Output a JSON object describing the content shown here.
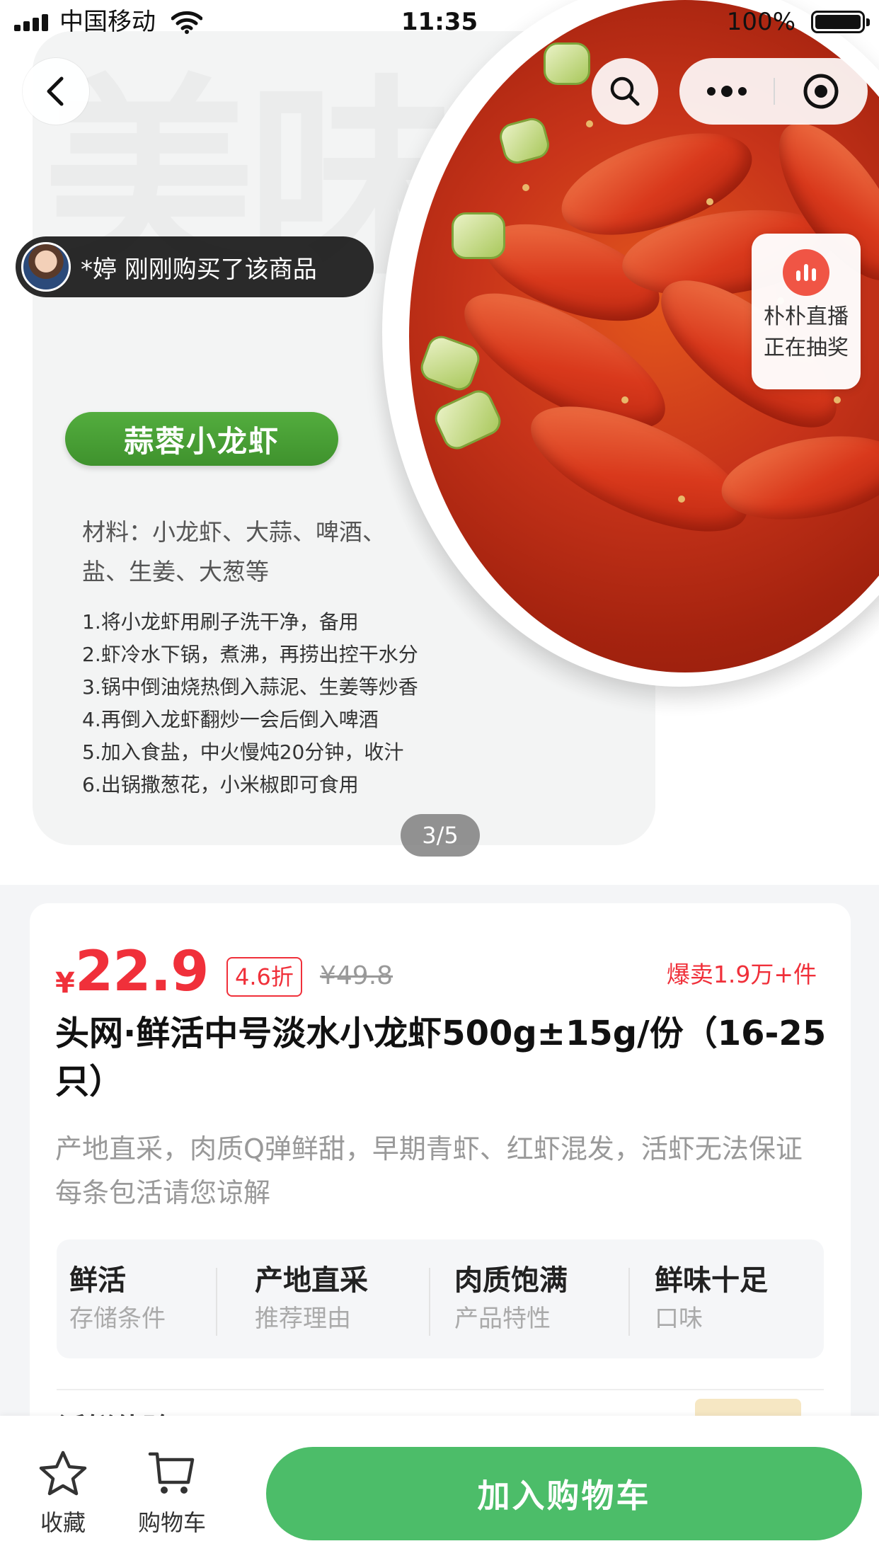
{
  "status_bar": {
    "carrier": "中国移动",
    "time": "11:35",
    "battery": "100%"
  },
  "hero": {
    "watermark": "美味",
    "purchase_toast": "*婷 刚刚购买了该商品",
    "live_badge": {
      "line1": "朴朴直播",
      "line2": "正在抽奖"
    },
    "dish_tag": "蒜蓉小龙虾",
    "materials": [
      "材料：小龙虾、大蒜、啤酒、",
      "盐、生姜、大葱等"
    ],
    "steps": [
      "1.将小龙虾用刷子洗干净，备用",
      "2.虾冷水下锅，煮沸，再捞出控干水分",
      "3.锅中倒油烧热倒入蒜泥、生姜等炒香",
      "4.再倒入龙虾翻炒一会后倒入啤酒",
      "5.加入食盐，中火慢炖20分钟，收汁",
      "6.出锅撒葱花，小米椒即可食用"
    ],
    "page_indicator": "3/5"
  },
  "product": {
    "currency": "¥",
    "price": "22.9",
    "discount": "4.6折",
    "original_price": "¥49.8",
    "sales": "爆卖1.9万+件",
    "title": "头网·鲜活中号淡水小龙虾500g±15g/份（16-25只）",
    "subtitle": "产地直采，肉质Q弹鲜甜，早期青虾、红虾混发，活虾无法保证每条包活请您谅解",
    "attributes": [
      {
        "value": "鲜活",
        "key": "存储条件"
      },
      {
        "value": "产地直采",
        "key": "推荐理由"
      },
      {
        "value": "肉质饱满",
        "key": "产品特性"
      },
      {
        "value": "鲜味十足",
        "key": "口味"
      }
    ],
    "next_section_peek": "活鲜体验"
  },
  "bottom_bar": {
    "favorite_label": "收藏",
    "cart_label": "购物车",
    "add_to_cart": "加入购物车"
  },
  "colors": {
    "brand_green": "#4cbd69",
    "price_red": "#f0303a",
    "tag_green": "#53ad3e"
  },
  "icons": [
    "back-icon",
    "search-icon",
    "more-icon",
    "target-icon",
    "live-icon",
    "star-icon",
    "cart-icon"
  ]
}
